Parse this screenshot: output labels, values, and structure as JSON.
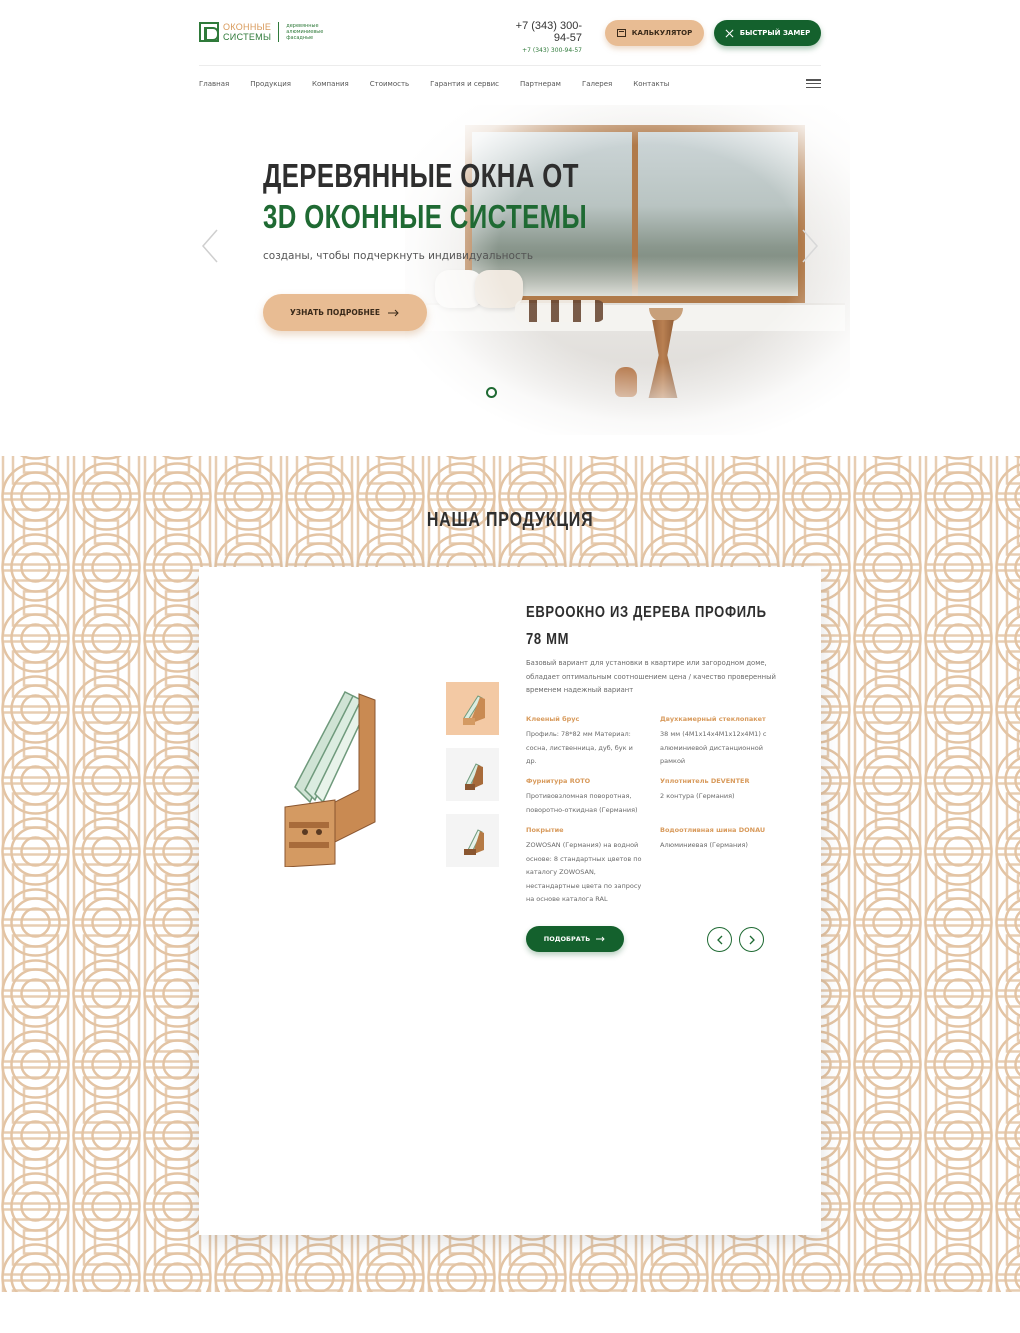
{
  "header": {
    "logo": {
      "name_line1": "ОКОННЫЕ",
      "name_line2": "СИСТЕМЫ",
      "tag_line1": "деревянные",
      "tag_line2": "алюминиевые",
      "tag_line3": "фасадные"
    },
    "phone_main": "+7 (343) 300-94-57",
    "phone_sub": "+7 (343) 300-94-57",
    "calc_button": "КАЛЬКУЛЯТОР",
    "measure_button": "БЫСТРЫЙ ЗАМЕР",
    "nav": [
      "Главная",
      "Продукция",
      "Компания",
      "Стоимость",
      "Гарантия и сервис",
      "Партнерам",
      "Галерея",
      "Контакты"
    ]
  },
  "hero": {
    "title_line1": "ДЕРЕВЯННЫЕ ОКНА ОТ",
    "title_line2": "3D ОКОННЫЕ СИСТЕМЫ",
    "subtitle": "созданы, чтобы подчеркнуть индивидуальность",
    "button": "УЗНАТЬ ПОДРОБНЕЕ"
  },
  "products": {
    "section_title": "НАША ПРОДУКЦИЯ",
    "title_line1": "ЕВРООКНО ИЗ ДЕРЕВА ПРОФИЛЬ",
    "title_line2": "78 ММ",
    "description": "Базовый вариант для установки в квартире или загородном доме, обладает оптимальным соотношением цена / качество проверенный временем надежный вариант",
    "specs": [
      {
        "title": "Клееный брус",
        "value": "Профиль: 78*82 мм Материал: сосна, лиственница, дуб, бук и др."
      },
      {
        "title": "Двухкамерный стеклопакет",
        "value": "38 мм (4М1х14х4М1х12х4М1) с алюминиевой дистанционной рамкой"
      },
      {
        "title": "Фурнитура ROTO",
        "value": "Противовзломная поворотная, поворотно-откидная (Германия)"
      },
      {
        "title": "Уплотнитель DEVENTER",
        "value": "2 контура (Германия)"
      },
      {
        "title": "Покрытие",
        "value": "ZOWOSAN (Германия) на водной основе: 8 стандартных цветов по каталогу ZOWOSAN, нестандартные цвета по запросу на основе каталога RAL"
      },
      {
        "title": "Водоотливная шина DONAU",
        "value": "Алюминиевая (Германия)"
      }
    ],
    "pick_button": "ПОДОБРАТЬ"
  },
  "colors": {
    "green": "#14612d",
    "accent": "#e8bc93",
    "pattern": "#e3c4a4"
  }
}
